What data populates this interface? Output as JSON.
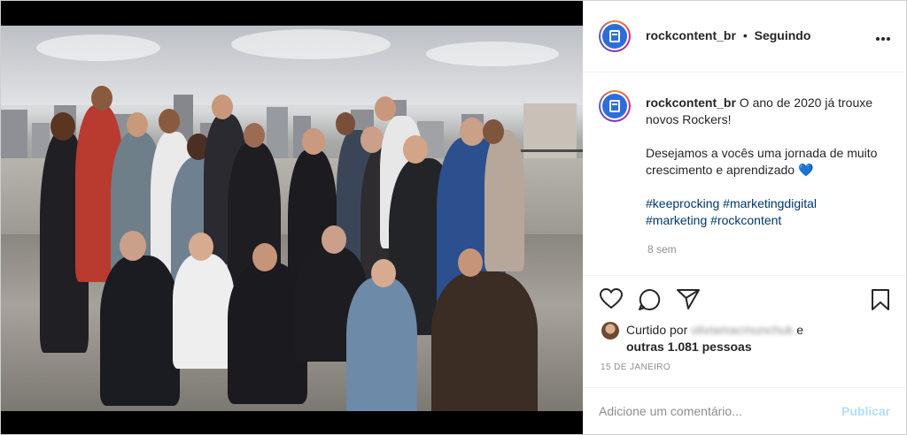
{
  "post": {
    "header": {
      "username": "rockcontent_br",
      "separator": "•",
      "follow_status": "Seguindo",
      "more_icon": "more-horizontal-icon"
    },
    "photo": {
      "icon": "group-photo"
    },
    "caption": {
      "username": "rockcontent_br",
      "text_line1": "O ano de 2020 já trouxe novos Rockers!",
      "text_line2": "Desejamos a vocês uma jornada de muito crescimento e aprendizado",
      "heart_emoji": "💙",
      "hashtags": [
        "#keeprocking",
        "#marketingdigital",
        "#marketing",
        "#rockcontent"
      ],
      "age": "8 sem"
    },
    "actions": {
      "like_icon": "heart-icon",
      "comment_icon": "comment-icon",
      "share_icon": "send-icon",
      "save_icon": "bookmark-icon"
    },
    "likes": {
      "prefix": "Curtido por",
      "blurred_user": "oliviamacmunchuk",
      "conjunction": "e",
      "others": "outras 1.081 pessoas"
    },
    "date": "15 DE JANEIRO",
    "comment_box": {
      "placeholder": "Adicione um comentário...",
      "publish_label": "Publicar"
    },
    "colors": {
      "link": "#00376b",
      "publish_disabled": "#b2dffc",
      "avatar_core": "#2c6ed9"
    }
  }
}
